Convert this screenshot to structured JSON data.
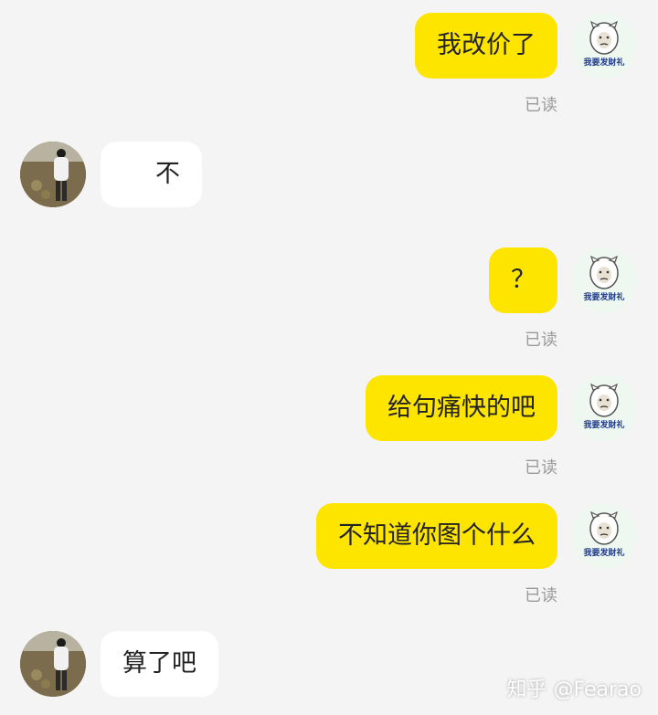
{
  "messages": [
    {
      "side": "me",
      "text": "我改价了",
      "status": "已读"
    },
    {
      "side": "other",
      "text": "不"
    },
    {
      "side": "me",
      "text": "？",
      "status": "已读"
    },
    {
      "side": "me",
      "text": "给句痛快的吧",
      "status": "已读"
    },
    {
      "side": "me",
      "text": "不知道你图个什么",
      "status": "已读"
    },
    {
      "side": "other",
      "text": "算了吧"
    }
  ],
  "sticker_text": "我要发財礼",
  "watermark": "知乎 @Fearao",
  "colors": {
    "my_bubble": "#fee500",
    "other_bubble": "#ffffff",
    "background": "#f4f4f4",
    "read_status": "#9a9a9a"
  }
}
